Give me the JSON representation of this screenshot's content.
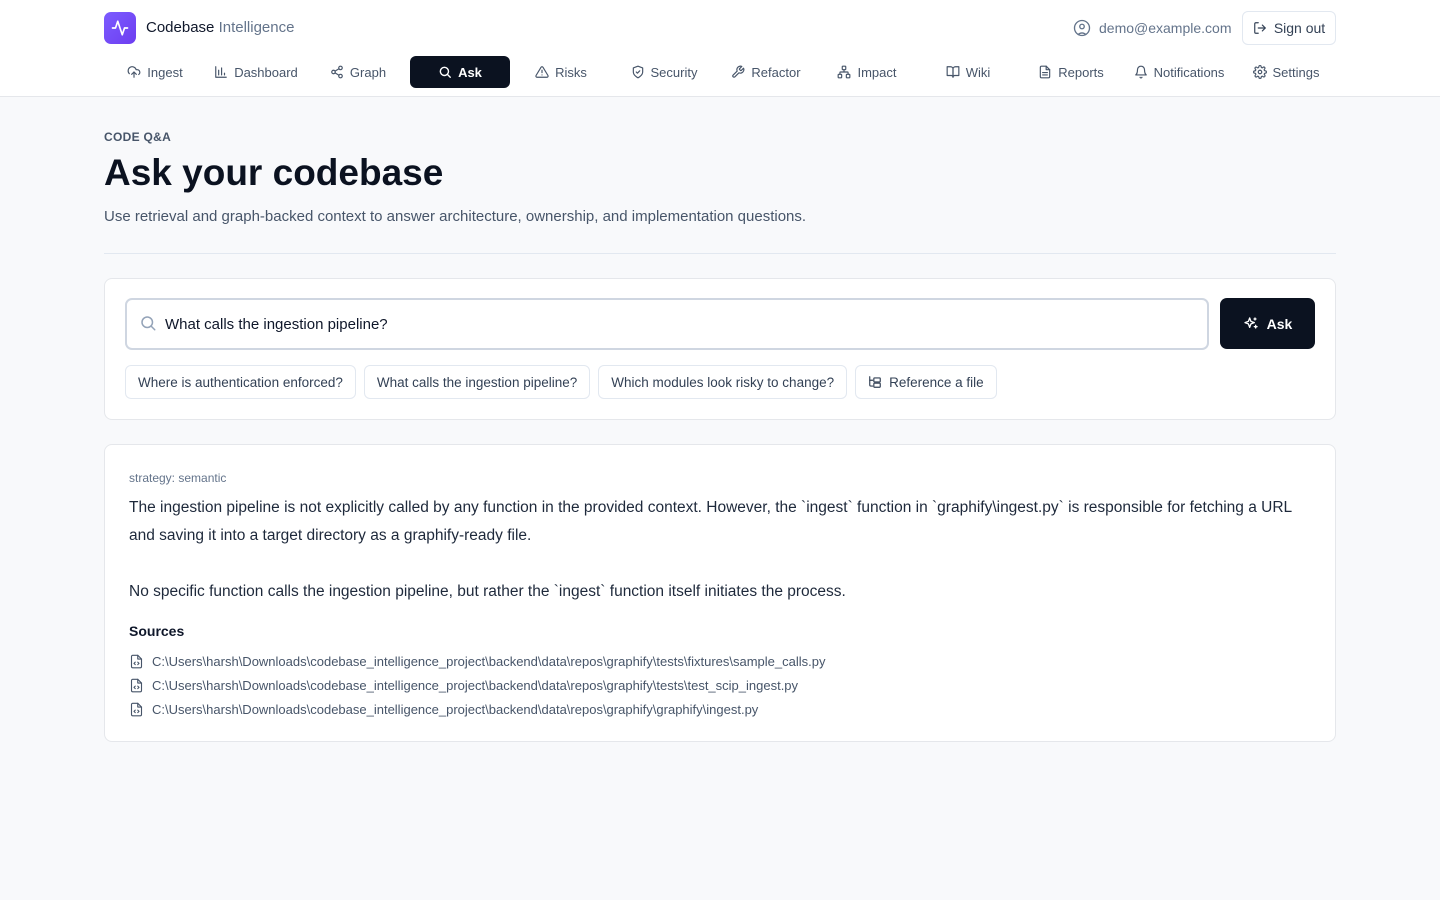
{
  "brand": {
    "name": "Codebase",
    "suffix": "Intelligence"
  },
  "user": {
    "email": "demo@example.com",
    "signout_label": "Sign out"
  },
  "nav": {
    "items": [
      {
        "label": "Ingest",
        "icon": "cloud-upload-icon"
      },
      {
        "label": "Dashboard",
        "icon": "bar-chart-icon"
      },
      {
        "label": "Graph",
        "icon": "share-icon"
      },
      {
        "label": "Ask",
        "icon": "search-icon",
        "active": true
      },
      {
        "label": "Risks",
        "icon": "warning-icon"
      },
      {
        "label": "Security",
        "icon": "shield-icon"
      },
      {
        "label": "Refactor",
        "icon": "wrench-icon"
      },
      {
        "label": "Impact",
        "icon": "network-icon"
      },
      {
        "label": "Wiki",
        "icon": "book-icon"
      },
      {
        "label": "Reports",
        "icon": "document-icon"
      },
      {
        "label": "Notifications",
        "icon": "bell-icon"
      },
      {
        "label": "Settings",
        "icon": "gear-icon"
      }
    ]
  },
  "page": {
    "eyebrow": "CODE Q&A",
    "title": "Ask your codebase",
    "subtitle": "Use retrieval and graph-backed context to answer architecture, ownership, and implementation questions."
  },
  "search": {
    "value": "What calls the ingestion pipeline?",
    "ask_label": "Ask",
    "suggestions": [
      "Where is authentication enforced?",
      "What calls the ingestion pipeline?",
      "Which modules look risky to change?"
    ],
    "reference_label": "Reference a file"
  },
  "result": {
    "strategy": "strategy: semantic",
    "answer_p1": "The ingestion pipeline is not explicitly called by any function in the provided context. However, the `ingest` function in `graphify\\ingest.py` is responsible for fetching a URL and saving it into a target directory as a graphify-ready file.",
    "answer_p2": "No specific function calls the ingestion pipeline, but rather the `ingest` function itself initiates the process.",
    "sources_title": "Sources",
    "sources": [
      "C:\\Users\\harsh\\Downloads\\codebase_intelligence_project\\backend\\data\\repos\\graphify\\tests\\fixtures\\sample_calls.py",
      "C:\\Users\\harsh\\Downloads\\codebase_intelligence_project\\backend\\data\\repos\\graphify\\tests\\test_scip_ingest.py",
      "C:\\Users\\harsh\\Downloads\\codebase_intelligence_project\\backend\\data\\repos\\graphify\\graphify\\ingest.py"
    ]
  },
  "colors": {
    "brand": "#6d3df0",
    "primary": "#0b1220",
    "background": "#f8f9fb"
  }
}
